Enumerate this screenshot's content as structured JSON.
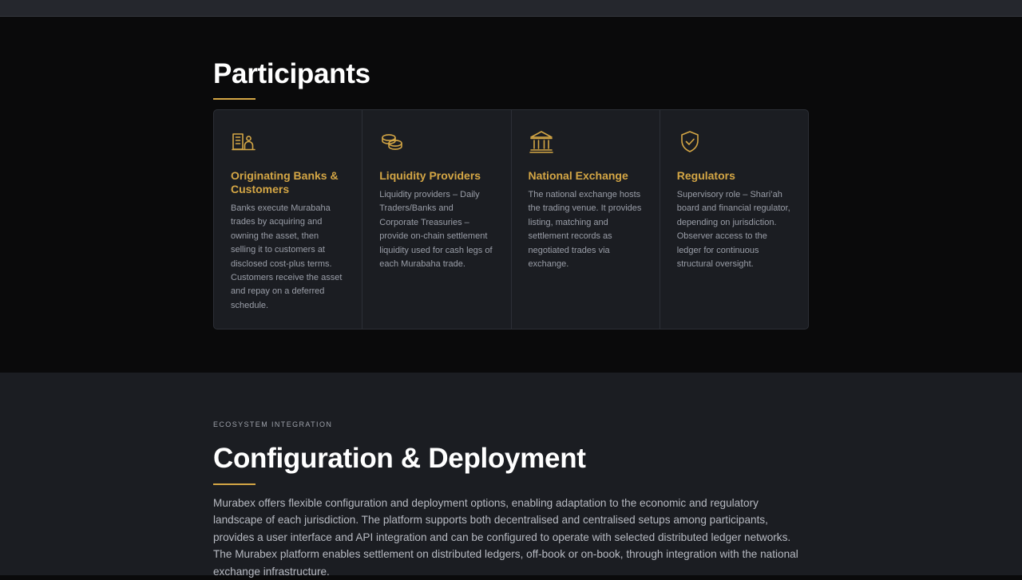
{
  "participants": {
    "title": "Participants",
    "cards": [
      {
        "icon": "bank-customer-icon",
        "title": "Originating Banks & Customers",
        "text": "Banks execute Murabaha trades by acquiring and owning the asset, then selling it to customers at disclosed cost-plus terms. Customers receive the asset and repay on a deferred schedule."
      },
      {
        "icon": "coins-icon",
        "title": "Liquidity Providers",
        "text": "Liquidity providers – Daily Traders/Banks and Corporate Treasuries – provide on-chain settlement liquidity used for cash legs of each Murabaha trade."
      },
      {
        "icon": "exchange-building-icon",
        "title": "National Exchange",
        "text": "The national exchange hosts the trading venue. It provides listing, matching and settlement records as negotiated trades via exchange."
      },
      {
        "icon": "shield-check-icon",
        "title": "Regulators",
        "text": "Supervisory role – Shari’ah board and financial regulator, depending on jurisdiction. Observer access to the ledger for continuous structural oversight."
      }
    ]
  },
  "config": {
    "eyebrow": "ECOSYSTEM INTEGRATION",
    "title": "Configuration & Deployment",
    "body": "Murabex offers flexible configuration and deployment options, enabling adaptation to the economic and regulatory landscape of each jurisdiction. The platform supports both decentralised and centralised setups among participants, provides a user interface and API integration and can be configured to operate with selected distributed ledger networks. The Murabex platform enables settlement on distributed ledgers, off-book or on-book, through integration with the national exchange infrastructure."
  },
  "colors": {
    "accent": "#d4a645",
    "background": "#0a0a0b",
    "card_background": "#1b1d22"
  }
}
